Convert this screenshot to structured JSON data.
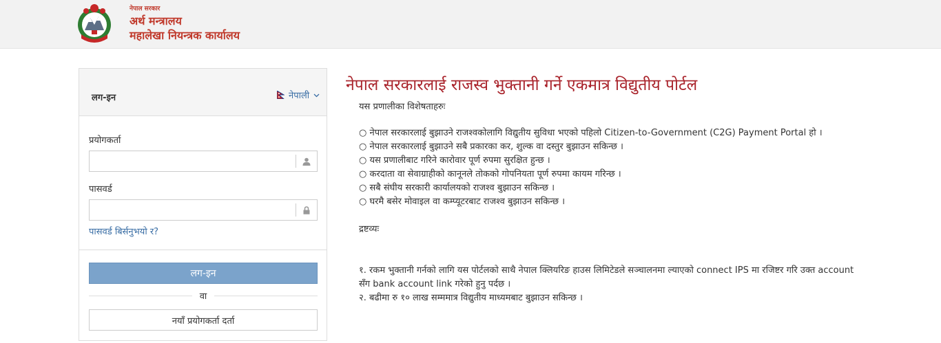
{
  "header": {
    "gov_small": "नेपाल सरकार",
    "ministry": "अर्थ मन्त्रालय",
    "office": "महालेखा नियन्त्रक कार्यालय",
    "logo_icon": "nepal-emblem-icon"
  },
  "login": {
    "title": "लग-इन",
    "language": "नेपाली",
    "username_label": "प्रयोगकर्ता",
    "username_value": "",
    "username_placeholder": "",
    "password_label": "पासवर्ड",
    "password_value": "",
    "password_placeholder": "",
    "forgot_link": "पासवर्ड बिर्सनुभयो र?",
    "login_button": "लग-इन",
    "or_text": "वा",
    "register_button": "नयाँ प्रयोगकर्ता दर्ता"
  },
  "content": {
    "portal_title": "नेपाल सरकारलाई राजस्व भुक्तानी गर्ने एकमात्र विद्युतीय पोर्टल",
    "features_intro": "यस प्रणालीका विशेषताहरुः",
    "features": [
      "○ नेपाल सरकारलाई बुझाउने राजश्वकोलागि विद्युतीय सुविधा भएको पहिलो Citizen-to-Government (C2G) Payment Portal हो ।",
      "○ नेपाल सरकारलाई बुझाउने सबै प्रकारका कर, शुल्क वा दस्तुर बुझाउन सकिन्छ ।",
      "○ यस प्रणालीबाट गरिने कारोवार पूर्ण रुपमा सुरक्षित हुन्छ ।",
      "○ करदाता वा सेवाग्राहीको कानूनले तोकको गोपनियता पूर्ण रुपमा कायम गरिन्छ ।",
      "○ सबै संघीय सरकारी कार्यालयको राजश्व बुझाउन सकिन्छ ।",
      "○ घरमै बसेर मोवाइल वा कम्प्यूटरबाट राजश्व बुझाउन सकिन्छ ।"
    ],
    "notes_heading": "द्रष्टव्यः",
    "notes": [
      "१. रकम भुक्तानी गर्नको लागि यस पोर्टलको साथै नेपाल क्लियरिङ हाउस लिमिटेडले सञ्चालनमा ल्याएको connect IPS मा रजिष्टर गरि उक्त account सँग bank account link गरेको हुनु पर्दछ ।",
      "२. बढीमा रु १० लाख सम्ममात्र विद्युतीय माध्यमबाट बुझाउन सकिन्छ ।"
    ]
  },
  "colors": {
    "header_bg": "#f2f2f2",
    "brand_red": "#c0392b",
    "title_red": "#a9232b",
    "link_blue": "#3a6ea5",
    "login_button_bg": "#7ba3cb"
  }
}
